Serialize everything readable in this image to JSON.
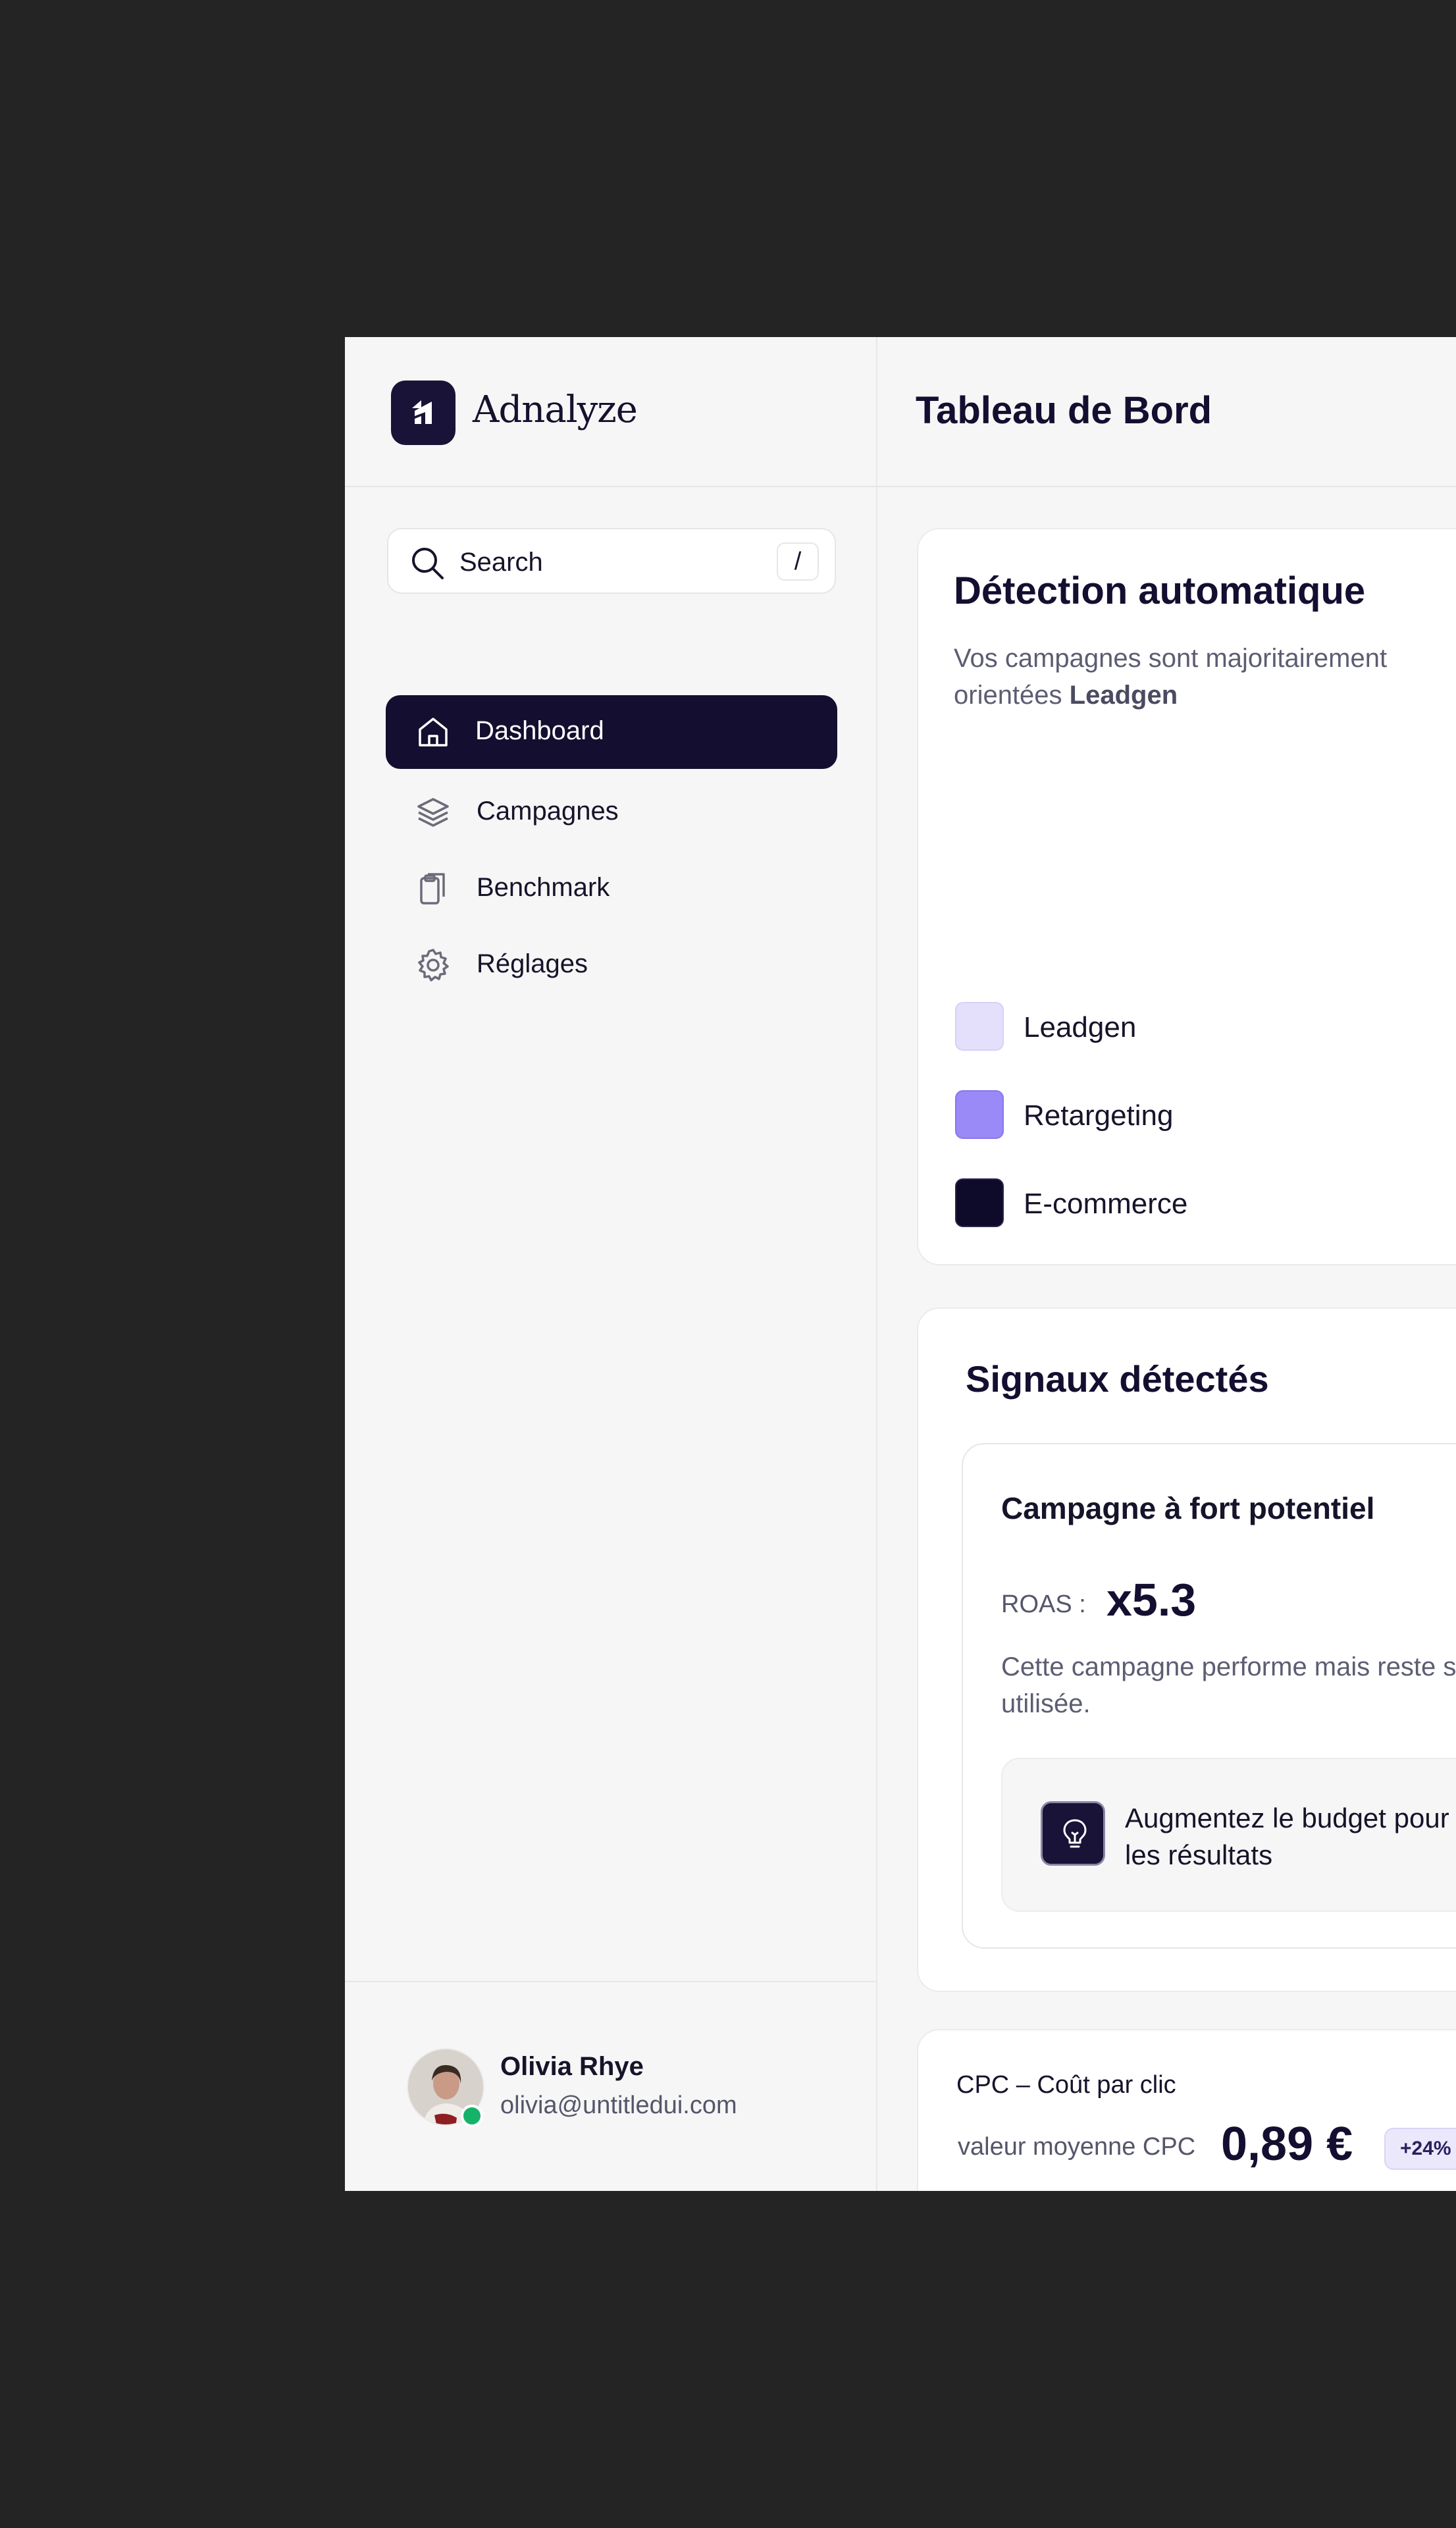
{
  "brand": {
    "name": "Adnalyze"
  },
  "search": {
    "placeholder": "Search",
    "shortcut": "/"
  },
  "nav": {
    "items": [
      {
        "label": "Dashboard",
        "icon": "home-icon",
        "active": true
      },
      {
        "label": "Campagnes",
        "icon": "layers-icon",
        "active": false
      },
      {
        "label": "Benchmark",
        "icon": "clipboard-icon",
        "active": false
      },
      {
        "label": "Réglages",
        "icon": "gear-icon",
        "active": false
      }
    ]
  },
  "user": {
    "name": "Olivia Rhye",
    "email": "olivia@untitledui.com",
    "status": "online"
  },
  "header": {
    "title": "Tableau de Bord"
  },
  "detection": {
    "title": "Détection automatique",
    "subtitle_prefix": "Vos campagnes sont majoritairement orientées ",
    "subtitle_bold": "Leadgen",
    "legend": [
      {
        "label": "Leadgen",
        "color": "#e4e0fb"
      },
      {
        "label": "Retargeting",
        "color": "#9a8af7"
      },
      {
        "label": "E-commerce",
        "color": "#0e0a2a"
      }
    ]
  },
  "signals": {
    "title": "Signaux détectés",
    "card": {
      "title": "Campagne à fort potentiel",
      "metric_label": "ROAS :",
      "metric_value": "x5.3",
      "description": "Cette campagne performe mais reste sous-utilisée.",
      "tip": "Augmentez le budget pour amplifier les résultats",
      "tip_icon": "lightbulb-icon"
    }
  },
  "cpc": {
    "title": "CPC – Coût par clic",
    "label": "valeur moyenne CPC",
    "value": "0,89 €",
    "badge": "+24%"
  },
  "colors": {
    "background": "#252425",
    "app_bg": "#f6f6f6",
    "primary_dark": "#140f30",
    "success": "#17b26a"
  }
}
